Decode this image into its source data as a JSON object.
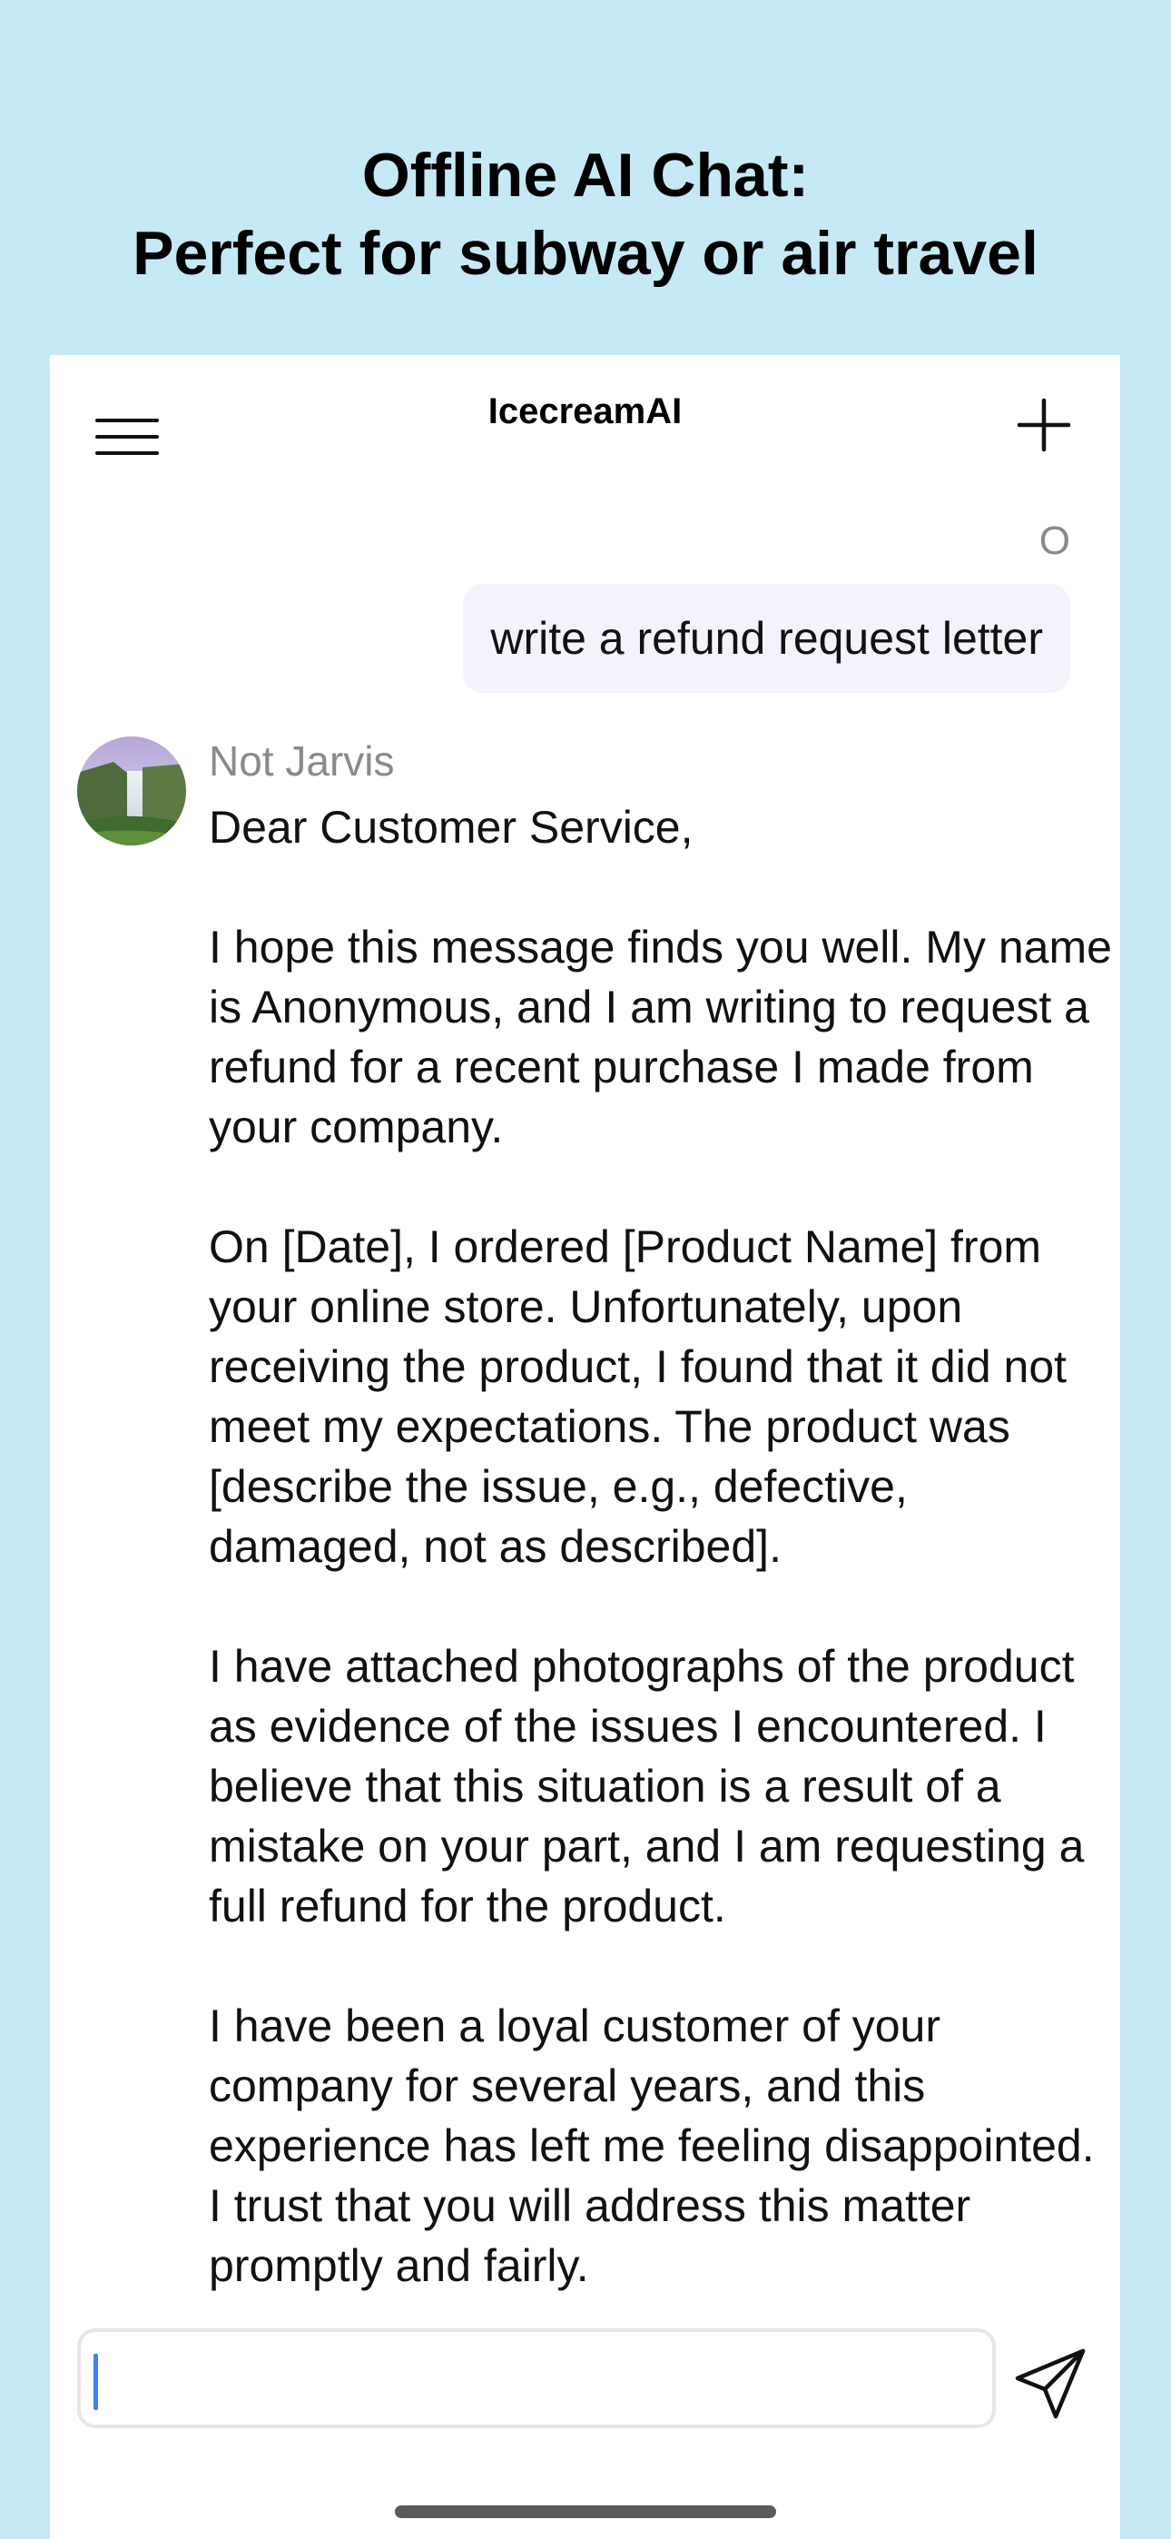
{
  "promo": {
    "title_line1": "Offline AI Chat:",
    "title_line2": "Perfect for subway or air travel"
  },
  "header": {
    "title": "IcecreamAI",
    "menu_icon": "hamburger-menu-icon",
    "new_chat_icon": "plus-icon"
  },
  "chat": {
    "user_name": "O",
    "user_message": "write a refund request letter",
    "bot_name": "Not Jarvis",
    "bot_avatar": "waterfall-landscape-avatar",
    "bot_paragraphs": [
      "Dear Customer Service,",
      "I hope this message finds you well. My name is Anonymous, and I am writing to request a refund for a recent purchase I made from your company.",
      "On [Date], I ordered [Product Name] from your online store. Unfortunately, upon receiving the product, I found that it did not meet my expectations. The product was [describe the issue, e.g., defective, damaged, not as described].",
      "I have attached photographs of the product as evidence of the issues I encountered. I believe that this situation is a result of a mistake on your part, and I am requesting a full refund for the product.",
      "I have been a loyal customer of your company for several years, and this experience has left me feeling disappointed. I trust that you will address this matter promptly and fairly."
    ]
  },
  "composer": {
    "value": "",
    "send_icon": "paper-plane-send-icon"
  },
  "colors": {
    "background": "#c6e9f6",
    "user_bubble": "#f2f3fb",
    "caret": "#3b82f6",
    "muted_text": "#8a8a8e"
  }
}
